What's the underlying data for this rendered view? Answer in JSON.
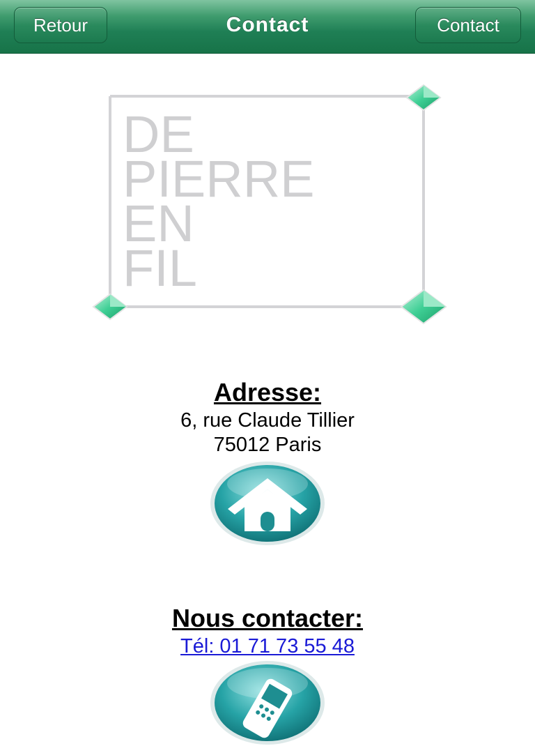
{
  "navbar": {
    "back_label": "Retour",
    "title": "Contact",
    "contact_label": "Contact"
  },
  "logo": {
    "lines": [
      "DE",
      "PIERRE",
      "EN",
      "FIL"
    ]
  },
  "address": {
    "heading": "Adresse:",
    "street": "6, rue Claude Tillier",
    "city": "75012 Paris",
    "icon": "home-icon"
  },
  "contact": {
    "heading": "Nous contacter:",
    "phone": "Tél: 01 71 73 55 48",
    "icon": "mobile-phone-icon"
  },
  "colors": {
    "navbar_green": "#1f7f55",
    "teal_button": "#1e9a9c",
    "logo_gray": "#cfcfd1",
    "diamond_green": "#3fcf95",
    "link_blue": "#1a1ad6"
  }
}
